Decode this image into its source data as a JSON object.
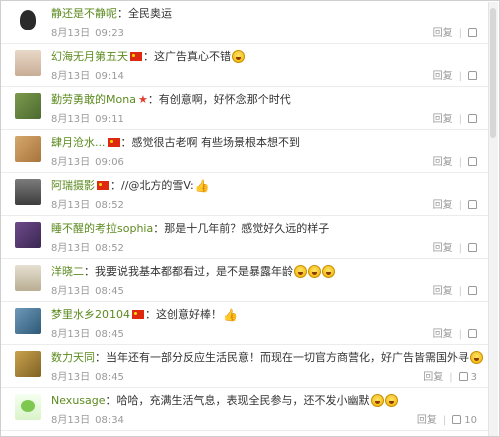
{
  "labels": {
    "reply": "回复",
    "separator": "|"
  },
  "comments": [
    {
      "name": "静还是不静呢",
      "text": "：全民奥运",
      "date": "8月13日",
      "time": "09:23",
      "flag": false,
      "star": false,
      "emojis": [],
      "likes": ""
    },
    {
      "name": "幻海无月第五天",
      "text": "：这广告真心不错",
      "date": "8月13日",
      "time": "09:14",
      "flag": true,
      "star": false,
      "emojis": [
        "laugh"
      ],
      "likes": ""
    },
    {
      "name": "勤劳勇敢的Mona",
      "text": "：有创意啊，好怀念那个时代",
      "date": "8月13日",
      "time": "09:11",
      "flag": false,
      "star": true,
      "emojis": [],
      "likes": ""
    },
    {
      "name": "肆月沧水...",
      "text": "：感觉很古老啊 有些场景根本想不到",
      "date": "8月13日",
      "time": "09:06",
      "flag": true,
      "star": false,
      "emojis": [],
      "likes": ""
    },
    {
      "name": "阿瑞摄影",
      "text": "：//@北方的雪V:",
      "date": "8月13日",
      "time": "08:52",
      "flag": true,
      "star": false,
      "emojis": [
        "thumb"
      ],
      "likes": ""
    },
    {
      "name": "睡不醒的考拉sophia",
      "text": "：那是十几年前？感觉好久远的样子",
      "date": "8月13日",
      "time": "08:52",
      "flag": false,
      "star": false,
      "emojis": [],
      "likes": ""
    },
    {
      "name": "洋晓二",
      "text": "：我要说我基本都都看过，是不是暴露年龄",
      "date": "8月13日",
      "time": "08:45",
      "flag": false,
      "star": false,
      "emojis": [
        "laugh",
        "laugh",
        "laugh"
      ],
      "likes": ""
    },
    {
      "name": "梦里水乡20104",
      "text": "：这创意好棒！",
      "date": "8月13日",
      "time": "08:45",
      "flag": true,
      "star": false,
      "emojis": [
        "thumb"
      ],
      "likes": ""
    },
    {
      "name": "数力天同",
      "text": "：当年还有一部分反应生活民意！而现在一切官方商营化，好广告皆需国外寻",
      "date": "8月13日",
      "time": "08:45",
      "flag": false,
      "star": false,
      "emojis": [
        "laugh"
      ],
      "likes": "3"
    },
    {
      "name": "Nexusage",
      "text": "：哈哈，充满生活气息，表现全民参与，还不发小幽默",
      "date": "8月13日",
      "time": "08:34",
      "flag": false,
      "star": false,
      "emojis": [
        "laugh",
        "laugh"
      ],
      "likes": "10"
    }
  ]
}
